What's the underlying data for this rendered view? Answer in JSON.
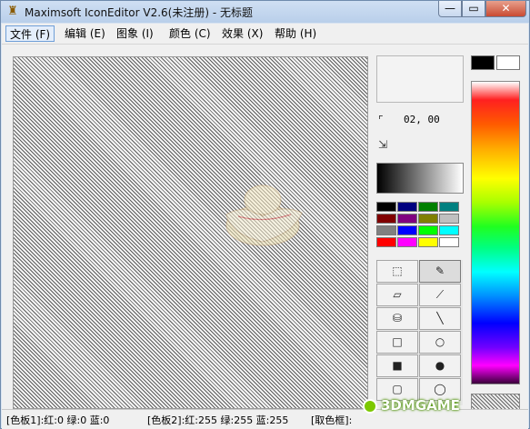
{
  "window": {
    "title": "Maximsoft IconEditor V2.6(未注册) - 无标题",
    "close_glyph": "✕",
    "min_glyph": "—",
    "max_glyph": "▭"
  },
  "menu": [
    {
      "label": "文件 (F)"
    },
    {
      "label": "编辑 (E)"
    },
    {
      "label": "图象 (I)"
    },
    {
      "label": "颜色 (C)"
    },
    {
      "label": "效果 (X)"
    },
    {
      "label": "帮助 (H)"
    }
  ],
  "coords": {
    "text": "02,  00"
  },
  "colors": {
    "foreground": "#000000",
    "background": "#ffffff",
    "palette": [
      "#000000",
      "#000080",
      "#008000",
      "#008080",
      "#800000",
      "#800080",
      "#808000",
      "#c0c0c0",
      "#808080",
      "#0000ff",
      "#00ff00",
      "#00ffff",
      "#ff0000",
      "#ff00ff",
      "#ffff00",
      "#ffffff"
    ]
  },
  "tools": [
    {
      "name": "select-rect-tool",
      "glyph": "⬚"
    },
    {
      "name": "pencil-tool",
      "glyph": "✎"
    },
    {
      "name": "eraser-tool",
      "glyph": "▱"
    },
    {
      "name": "eyedropper-tool",
      "glyph": "⟋"
    },
    {
      "name": "fill-bucket-tool",
      "glyph": "⛁"
    },
    {
      "name": "line-tool",
      "glyph": "╲"
    },
    {
      "name": "rectangle-tool",
      "glyph": "□"
    },
    {
      "name": "ellipse-tool",
      "glyph": "○"
    },
    {
      "name": "filled-rectangle-tool",
      "glyph": "■"
    },
    {
      "name": "filled-ellipse-tool",
      "glyph": "●"
    },
    {
      "name": "rounded-rect-tool",
      "glyph": "▢"
    },
    {
      "name": "ellipse-outline-tool",
      "glyph": "◯"
    }
  ],
  "status": {
    "palette1": "[色板1]:红:0 绿:0 蓝:0",
    "palette2": "[色板2]:红:255 绿:255 蓝:255",
    "picker": "[取色框]:"
  },
  "watermark": {
    "text": "3DMGAME"
  }
}
